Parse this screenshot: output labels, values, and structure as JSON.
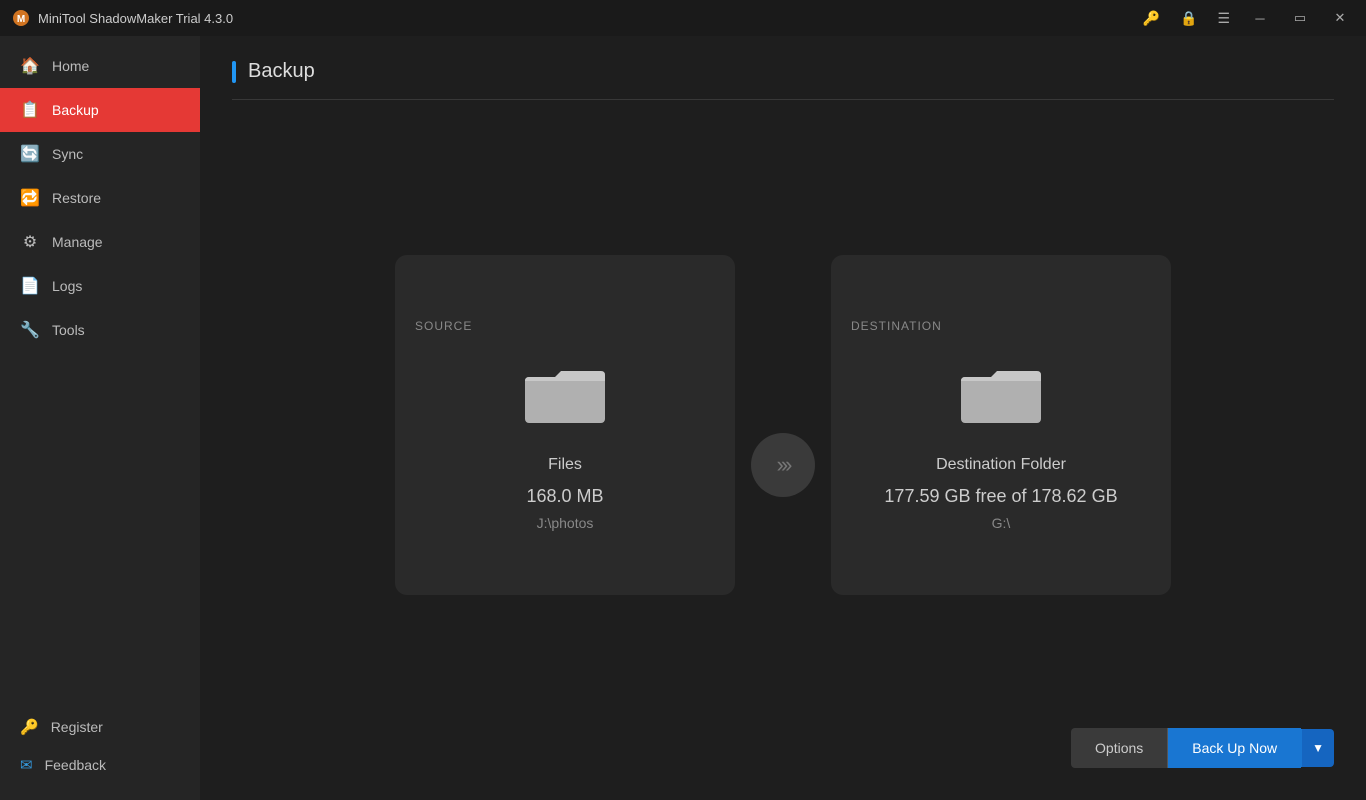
{
  "titlebar": {
    "logo": "⊛",
    "title": "MiniTool ShadowMaker Trial 4.3.0"
  },
  "sidebar": {
    "nav_items": [
      {
        "id": "home",
        "label": "Home",
        "icon": "🏠",
        "active": false
      },
      {
        "id": "backup",
        "label": "Backup",
        "icon": "📋",
        "active": true
      },
      {
        "id": "sync",
        "label": "Sync",
        "icon": "🔄",
        "active": false
      },
      {
        "id": "restore",
        "label": "Restore",
        "icon": "🔁",
        "active": false
      },
      {
        "id": "manage",
        "label": "Manage",
        "icon": "⚙",
        "active": false
      },
      {
        "id": "logs",
        "label": "Logs",
        "icon": "📄",
        "active": false
      },
      {
        "id": "tools",
        "label": "Tools",
        "icon": "🔧",
        "active": false
      }
    ],
    "footer_items": [
      {
        "id": "register",
        "label": "Register",
        "icon": "🔑"
      },
      {
        "id": "feedback",
        "label": "Feedback",
        "icon": "✉"
      }
    ]
  },
  "main": {
    "page_title": "Backup",
    "source": {
      "label": "SOURCE",
      "icon_type": "folder",
      "name": "Files",
      "size": "168.0 MB",
      "path": "J:\\photos"
    },
    "destination": {
      "label": "DESTINATION",
      "icon_type": "folder",
      "name": "Destination Folder",
      "free_space": "177.59 GB free of 178.62 GB",
      "path": "G:\\"
    },
    "arrow_symbol": "›››",
    "buttons": {
      "options": "Options",
      "backup_now": "Back Up Now",
      "dropdown_arrow": "▼"
    }
  }
}
